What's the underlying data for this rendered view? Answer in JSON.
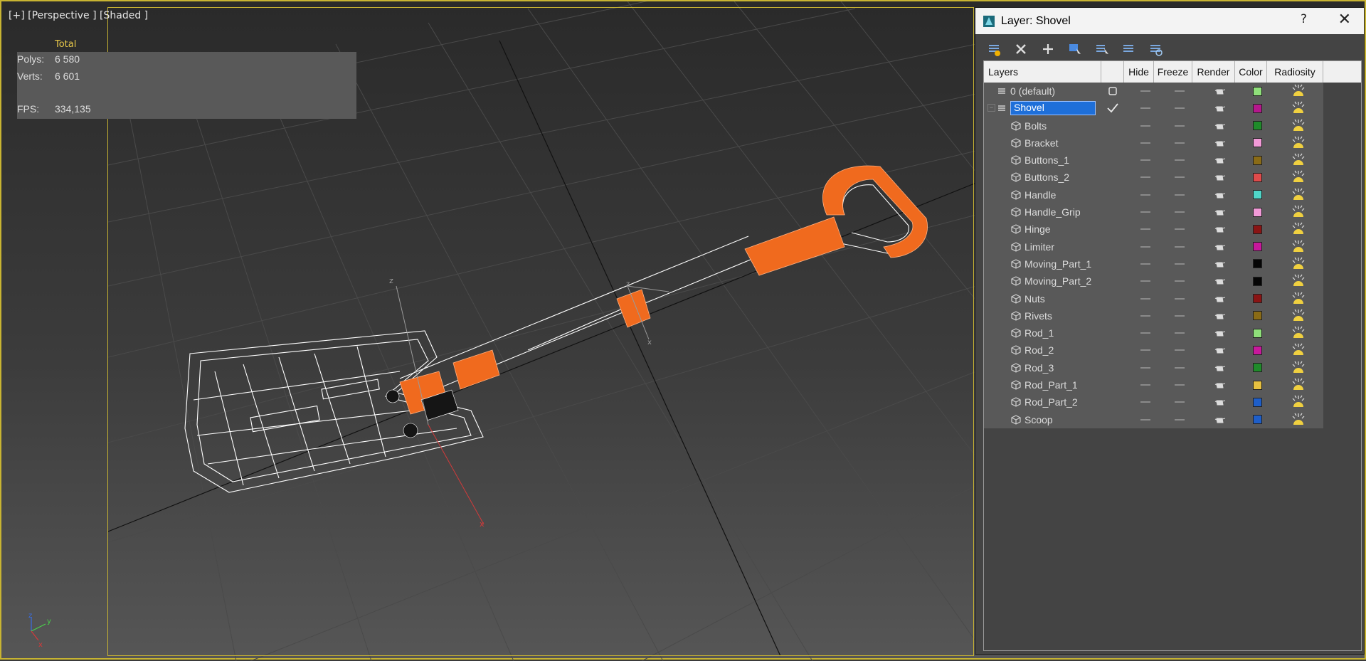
{
  "viewport": {
    "label_plus": "[+]",
    "label_view": "[Perspective ]",
    "label_shading": "[Shaded ]",
    "stats": {
      "total_label": "Total",
      "polys_label": "Polys:",
      "polys_value": "6 580",
      "verts_label": "Verts:",
      "verts_value": "6 601",
      "fps_label": "FPS:",
      "fps_value": "334,135"
    },
    "gizmo_labels": {
      "z": "z",
      "x": "x",
      "y": "y"
    },
    "wire_color": "#ffffff",
    "selection_color": "#f06a1e"
  },
  "dialog": {
    "title": "Layer: Shovel",
    "help": "?",
    "close": "✕",
    "toolbar_icons": [
      "create-layer-icon",
      "delete-layer-icon",
      "add-to-layer-icon",
      "select-objects-icon",
      "select-layer-icon",
      "layer-properties-icon",
      "hide-freeze-all-icon"
    ],
    "columns": [
      "Layers",
      "",
      "Hide",
      "Freeze",
      "Render",
      "Color",
      "Radiosity"
    ],
    "layers": [
      {
        "name": "0 (default)",
        "color": "#8fe07a",
        "type": "layer",
        "indent": 1,
        "current": "box",
        "selected": false
      },
      {
        "name": "Shovel",
        "color": "#b5178c",
        "type": "layer",
        "indent": 1,
        "current": "check",
        "selected": true
      },
      {
        "name": "Bolts",
        "color": "#1f8c2a",
        "type": "object",
        "indent": 2,
        "current": "",
        "selected": false
      },
      {
        "name": "Bracket",
        "color": "#f29ad8",
        "type": "object",
        "indent": 2,
        "current": "",
        "selected": false
      },
      {
        "name": "Buttons_1",
        "color": "#8a6b16",
        "type": "object",
        "indent": 2,
        "current": "",
        "selected": false
      },
      {
        "name": "Buttons_2",
        "color": "#e04b4b",
        "type": "object",
        "indent": 2,
        "current": "",
        "selected": false
      },
      {
        "name": "Handle",
        "color": "#4fd6c8",
        "type": "object",
        "indent": 2,
        "current": "",
        "selected": false
      },
      {
        "name": "Handle_Grip",
        "color": "#f29ad8",
        "type": "object",
        "indent": 2,
        "current": "",
        "selected": false
      },
      {
        "name": "Hinge",
        "color": "#8a1414",
        "type": "object",
        "indent": 2,
        "current": "",
        "selected": false
      },
      {
        "name": "Limiter",
        "color": "#c8189c",
        "type": "object",
        "indent": 2,
        "current": "",
        "selected": false
      },
      {
        "name": "Moving_Part_1",
        "color": "#050505",
        "type": "object",
        "indent": 2,
        "current": "",
        "selected": false
      },
      {
        "name": "Moving_Part_2",
        "color": "#050505",
        "type": "object",
        "indent": 2,
        "current": "",
        "selected": false
      },
      {
        "name": "Nuts",
        "color": "#8a1414",
        "type": "object",
        "indent": 2,
        "current": "",
        "selected": false
      },
      {
        "name": "Rivets",
        "color": "#8a6b16",
        "type": "object",
        "indent": 2,
        "current": "",
        "selected": false
      },
      {
        "name": "Rod_1",
        "color": "#8fe07a",
        "type": "object",
        "indent": 2,
        "current": "",
        "selected": false
      },
      {
        "name": "Rod_2",
        "color": "#c8189c",
        "type": "object",
        "indent": 2,
        "current": "",
        "selected": false
      },
      {
        "name": "Rod_3",
        "color": "#1f8c2a",
        "type": "object",
        "indent": 2,
        "current": "",
        "selected": false
      },
      {
        "name": "Rod_Part_1",
        "color": "#e6c040",
        "type": "object",
        "indent": 2,
        "current": "",
        "selected": false
      },
      {
        "name": "Rod_Part_2",
        "color": "#1e5ec8",
        "type": "object",
        "indent": 2,
        "current": "",
        "selected": false
      },
      {
        "name": "Scoop",
        "color": "#1e5ec8",
        "type": "object",
        "indent": 2,
        "current": "",
        "selected": false
      }
    ]
  }
}
